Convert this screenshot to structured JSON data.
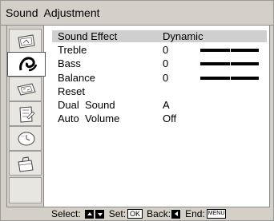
{
  "window": {
    "title": "Sound  Adjustment"
  },
  "menu_icons": [
    {
      "icon": "picture-icon",
      "selected": false
    },
    {
      "icon": "sound-icon",
      "selected": true
    },
    {
      "icon": "screen-icon",
      "selected": false
    },
    {
      "icon": "setup-icon",
      "selected": false
    },
    {
      "icon": "timer-icon",
      "selected": false
    },
    {
      "icon": "toolbox-icon",
      "selected": false
    },
    {
      "icon": "empty-slot",
      "selected": false
    }
  ],
  "settings": [
    {
      "label": "Sound Effect",
      "value": "Dynamic",
      "selected": true
    },
    {
      "label": "Treble",
      "value": "0",
      "slider_fraction": 0.5
    },
    {
      "label": "Bass",
      "value": "0",
      "slider_fraction": 0.5
    },
    {
      "label": "Balance",
      "value": "0",
      "slider_fraction": 0.5
    },
    {
      "label": "Reset",
      "value": ""
    },
    {
      "label": "Dual  Sound",
      "value": "A"
    },
    {
      "label": "Auto  Volume",
      "value": "Off"
    }
  ],
  "hint": {
    "select_label": "Select:",
    "set_label": "Set:",
    "set_key": "OK",
    "back_label": "Back:",
    "end_label": "End:",
    "end_key": "MENU"
  },
  "colors": {
    "background": "#d4d0c8",
    "panel": "#ffffff",
    "selection": "#cfcfcf"
  }
}
